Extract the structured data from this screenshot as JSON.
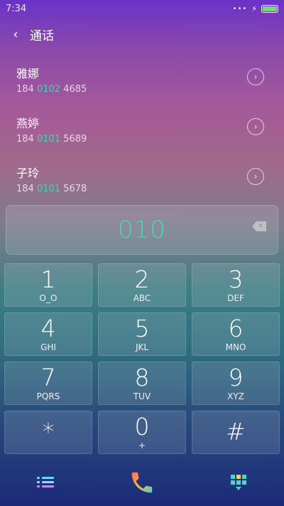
{
  "status": {
    "time": "7:34",
    "signal_dots": "•••"
  },
  "header": {
    "title": "通话"
  },
  "contacts": [
    {
      "name": "雅娜",
      "phone_prefix": "184 ",
      "phone_match": "0102",
      "phone_suffix": " 4685"
    },
    {
      "name": "燕婷",
      "phone_prefix": "184 ",
      "phone_match": "0101",
      "phone_suffix": " 5689"
    },
    {
      "name": "子玲",
      "phone_prefix": "184 ",
      "phone_match": "0101",
      "phone_suffix": " 5678"
    }
  ],
  "display": {
    "number": "010"
  },
  "keys": [
    {
      "digit": "1",
      "letters": "O_O"
    },
    {
      "digit": "2",
      "letters": "ABC"
    },
    {
      "digit": "3",
      "letters": "DEF"
    },
    {
      "digit": "4",
      "letters": "GHI"
    },
    {
      "digit": "5",
      "letters": "JKL"
    },
    {
      "digit": "6",
      "letters": "MNO"
    },
    {
      "digit": "7",
      "letters": "PQRS"
    },
    {
      "digit": "8",
      "letters": "TUV"
    },
    {
      "digit": "9",
      "letters": "XYZ"
    },
    {
      "digit": "*",
      "letters": ""
    },
    {
      "digit": "0",
      "letters": "+"
    },
    {
      "digit": "#",
      "letters": ""
    }
  ],
  "colors": {
    "accent": "#49d6b0",
    "battery": "#6fe06a"
  }
}
